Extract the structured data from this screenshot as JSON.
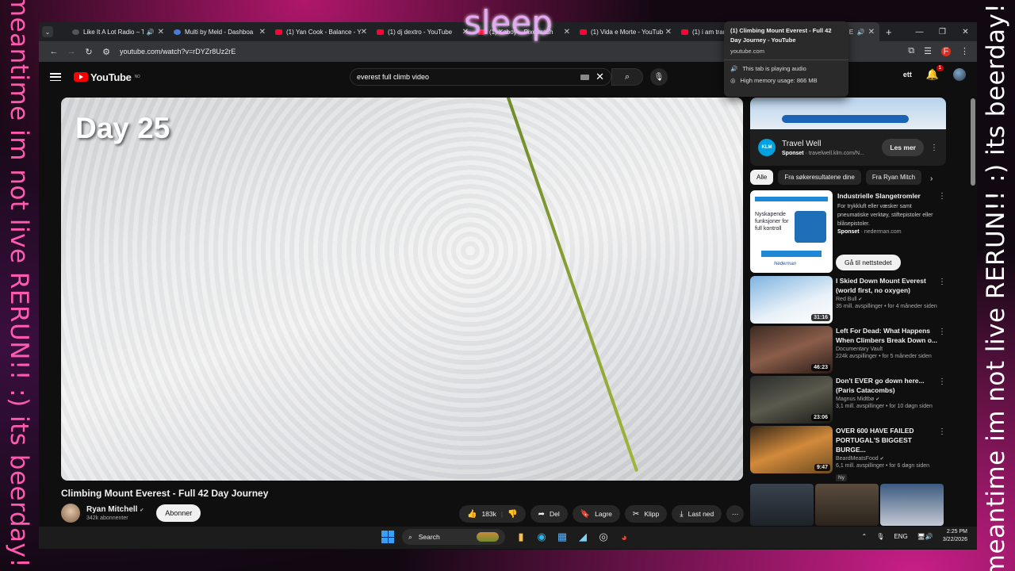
{
  "overlay": {
    "left_text": "meantime im not live RERUN!! :) its beerday!!",
    "right_text": "meantime im not live RERUN!! :) its beerday!!",
    "top_label": "sleep"
  },
  "tabs": [
    {
      "title": "Like It A Lot Radio – Ti",
      "audio": true,
      "favicon": "dark"
    },
    {
      "title": "Multi by Meld - Dashboa",
      "audio": false,
      "favicon": "blue"
    },
    {
      "title": "(1) Yan Cook - Balance - Y",
      "audio": false,
      "favicon": "youtube"
    },
    {
      "title": "(1) dj dextro - YouTube",
      "audio": false,
      "favicon": "youtube"
    },
    {
      "title": "(1) Kaboy – Pixelmash",
      "audio": false,
      "favicon": "youtube"
    },
    {
      "title": "(1) Vida e Morte - YouTub",
      "audio": false,
      "favicon": "youtube"
    },
    {
      "title": "(1) i am trance - YouTube",
      "audio": false,
      "favicon": "youtube"
    },
    {
      "title": "(1) Climbing Mount E",
      "audio": true,
      "favicon": "youtube",
      "active": true
    }
  ],
  "browser": {
    "url": "youtube.com/watch?v=rDYZr8Uz2rE",
    "profile_initial": "F"
  },
  "tooltip": {
    "title": "(1) Climbing Mount Everest - Full 42 Day Journey - YouTube",
    "host": "youtube.com",
    "audio_text": "This tab is playing audio",
    "memory_text": "High memory usage: 866 MB"
  },
  "youtube": {
    "logo_text": "YouTube",
    "logo_region": "NO",
    "search_query": "everest full climb video",
    "notification_count": "1",
    "create_label": "ett"
  },
  "video": {
    "overlay_text": "Day 25",
    "title": "Climbing Mount Everest - Full 42 Day Journey",
    "channel": "Ryan Mitchell",
    "subscribers": "342k abonnenter",
    "subscribe_label": "Abonner",
    "likes": "183k",
    "share_label": "Del",
    "save_label": "Lagre",
    "clip_label": "Klipp",
    "download_label": "Last ned"
  },
  "ad": {
    "name": "Travel Well",
    "sponsor": "Sponset",
    "domain": "travelwell.klm.com/N...",
    "cta": "Les mer",
    "logo_text": "KLM"
  },
  "chips": [
    "Alle",
    "Fra søkeresultatene dine",
    "Fra Ryan Mitch"
  ],
  "promo": {
    "title": "Industrielle Slangetromler",
    "desc": "For trykkluft eller væsker samt pneumatiske verktøy, stiftepistoler eller blåsepistoler.",
    "sponsor": "Sponset",
    "domain": "nederman.com",
    "cta": "Gå til nettstedet",
    "img_text": "Nyskapende funksjoner for full kontroll",
    "img_brand": "Nederman"
  },
  "recommendations": [
    {
      "title": "I Skied Down Mount Everest (world first, no oxygen)",
      "channel": "Red Bull",
      "meta": "35 mill. avspillinger • for 4 måneder siden",
      "duration": "31:16",
      "verified": true,
      "new": false
    },
    {
      "title": "Left For Dead: What Happens When Climbers Break Down o...",
      "channel": "Documentary Vault",
      "meta": "224k avspillinger • for 5 måneder siden",
      "duration": "46:23",
      "verified": false,
      "new": false
    },
    {
      "title": "Don't EVER go down here... (Paris Catacombs)",
      "channel": "Magnus Midtbø",
      "meta": "3,1 mill. avspillinger • for 10 døgn siden",
      "duration": "23:06",
      "verified": true,
      "new": false
    },
    {
      "title": "OVER 600 HAVE FAILED PORTUGAL'S BIGGEST BURGE...",
      "channel": "BeardMeatsFood",
      "meta": "6,1 mill. avspillinger • for 6 døgn siden",
      "duration": "9:47",
      "verified": true,
      "new": true,
      "new_label": "Ny"
    }
  ],
  "taskbar": {
    "search_placeholder": "Search",
    "lang": "ENG",
    "time": "2:25 PM",
    "date": "3/22/2026"
  }
}
